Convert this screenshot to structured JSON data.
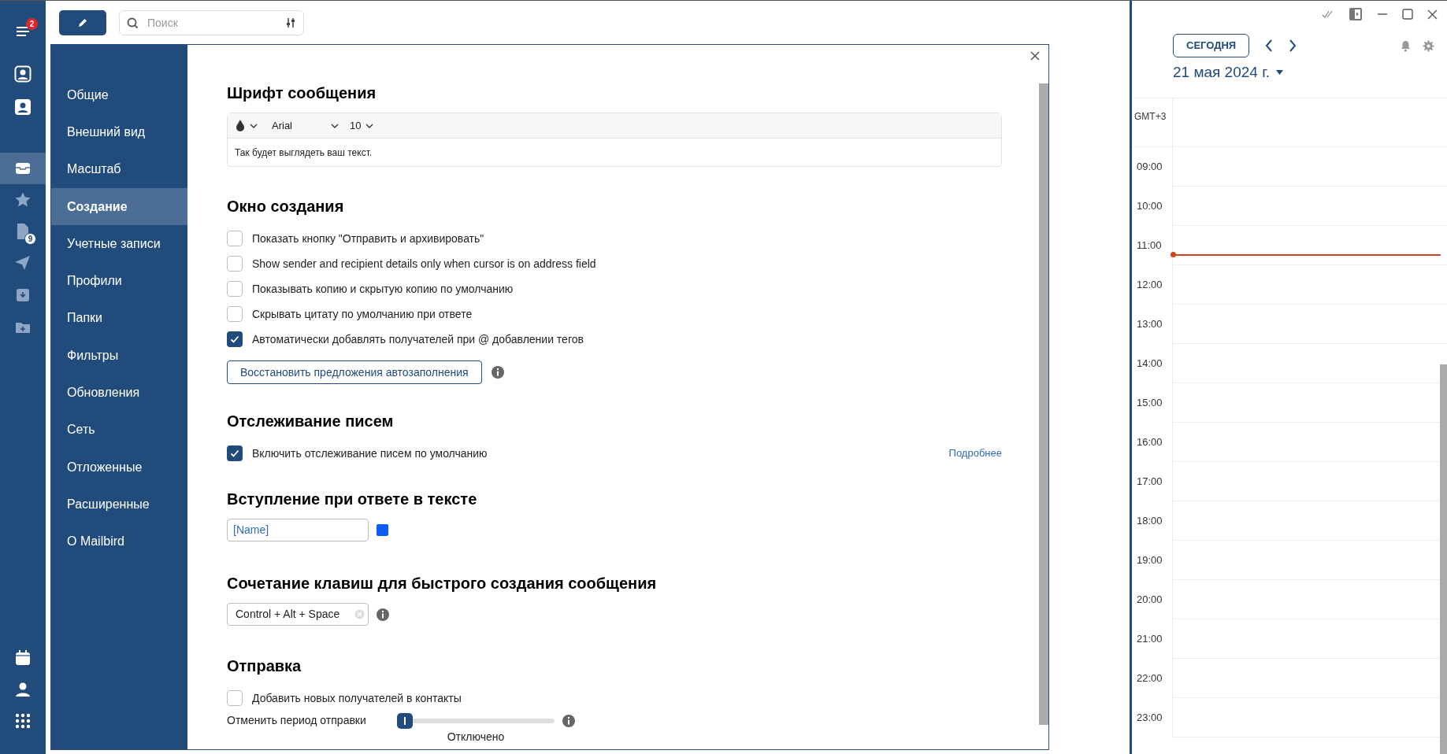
{
  "rail": {
    "top": [
      {
        "badge": "2",
        "selected": false
      },
      {
        "selected": false
      },
      {
        "selected": false
      },
      {
        "selected": true
      },
      {
        "selected": false
      },
      {
        "badge": "9",
        "selected": false
      },
      {
        "selected": false
      },
      {
        "selected": false
      },
      {
        "selected": false
      }
    ],
    "bottom": [
      {
        "selected": false
      },
      {
        "selected": false
      },
      {
        "selected": false
      }
    ]
  },
  "search": {
    "placeholder": "Поиск"
  },
  "settings": {
    "nav": [
      {
        "label": "Общие",
        "selected": false
      },
      {
        "label": "Внешний вид",
        "selected": false
      },
      {
        "label": "Масштаб",
        "selected": false
      },
      {
        "label": "Создание",
        "selected": true
      },
      {
        "label": "Учетные записи",
        "selected": false
      },
      {
        "label": "Профили",
        "selected": false
      },
      {
        "label": "Папки",
        "selected": false
      },
      {
        "label": "Фильтры",
        "selected": false
      },
      {
        "label": "Обновления",
        "selected": false
      },
      {
        "label": "Сеть",
        "selected": false
      },
      {
        "label": "Отложенные",
        "selected": false
      },
      {
        "label": "Расширенные",
        "selected": false
      },
      {
        "label": "О Mailbird",
        "selected": false
      }
    ],
    "font_section": {
      "heading": "Шрифт сообщения",
      "font": "Arial",
      "size": "10",
      "preview": "Так будет выглядеть ваш текст."
    },
    "compose_section": {
      "heading": "Окно создания",
      "options": [
        {
          "label": "Показать кнопку \"Отправить и архивировать\"",
          "checked": false
        },
        {
          "label": "Show sender and recipient details only when cursor is on address field",
          "checked": false
        },
        {
          "label": "Показывать копию и скрытую копию по умолчанию",
          "checked": false
        },
        {
          "label": "Скрывать цитату по умолчанию при ответе",
          "checked": false
        },
        {
          "label": "Автоматически добавлять получателей при @ добавлении тегов",
          "checked": true
        }
      ],
      "restore_button": "Восстановить предложения автозаполнения"
    },
    "tracking_section": {
      "heading": "Отслеживание писем",
      "options": [
        {
          "label": "Включить отслеживание писем по умолчанию",
          "checked": true
        }
      ],
      "link": "Подробнее"
    },
    "reply_intro_section": {
      "heading": "Вступление при ответе в тексте",
      "value": "[Name]",
      "color": "#0a5cf5"
    },
    "shortcut_section": {
      "heading": "Сочетание клавиш для быстрого создания сообщения",
      "value": "Control + Alt + Space"
    },
    "sending_section": {
      "heading": "Отправка",
      "options": [
        {
          "label": "Добавить новых получателей в контакты",
          "checked": false
        }
      ],
      "undo_slider": {
        "label": "Отменить период отправки",
        "level": 0,
        "reading": "Отключено"
      }
    }
  },
  "calendar": {
    "today_button": "СЕГОДНЯ",
    "date": "21 мая 2024 г.",
    "timezone": "GMT+3",
    "hours": [
      "09:00",
      "10:00",
      "11:00",
      "12:00",
      "13:00",
      "14:00",
      "15:00",
      "16:00",
      "17:00",
      "18:00",
      "19:00",
      "20:00",
      "21:00",
      "22:00",
      "23:00"
    ]
  }
}
